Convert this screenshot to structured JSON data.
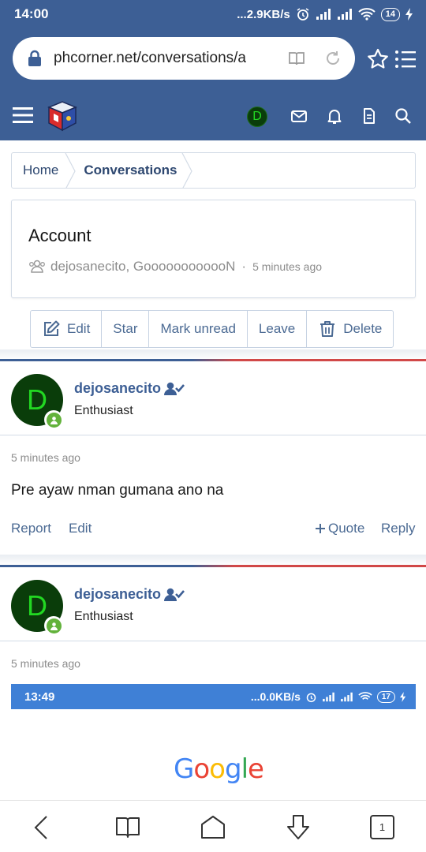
{
  "status_bar": {
    "time": "14:00",
    "network_speed": "...2.9KB/s",
    "battery": "14",
    "icons": [
      "alarm-icon",
      "signal-icon",
      "signal-icon",
      "wifi-icon",
      "battery-icon",
      "charging-icon"
    ]
  },
  "browser": {
    "url": "phcorner.net/conversations/a",
    "icons": [
      "lock-icon",
      "reader-mode-icon",
      "reload-icon",
      "bookmark-star-icon",
      "menu-icon"
    ]
  },
  "site_header": {
    "avatar_letter": "D",
    "icons": [
      "hamburger-icon",
      "logo",
      "mail-icon",
      "bell-icon",
      "document-icon",
      "search-icon"
    ]
  },
  "breadcrumb": {
    "home": "Home",
    "current": "Conversations"
  },
  "conversation": {
    "title": "Account",
    "participants": "dejosanecito, GoooooooooooN",
    "separator": "·",
    "time": "5 minutes ago"
  },
  "actions": {
    "edit": "Edit",
    "star": "Star",
    "mark_unread": "Mark unread",
    "leave": "Leave",
    "delete": "Delete"
  },
  "messages": [
    {
      "avatar_letter": "D",
      "username": "dejosanecito",
      "user_title": "Enthusiast",
      "time": "5 minutes ago",
      "body": "Pre ayaw nman gumana ano na",
      "report": "Report",
      "edit": "Edit",
      "quote": "Quote",
      "reply": "Reply"
    },
    {
      "avatar_letter": "D",
      "username": "dejosanecito",
      "user_title": "Enthusiast",
      "time": "5 minutes ago"
    }
  ],
  "embedded_screenshot": {
    "time": "13:49",
    "network_speed": "...0.0KB/s",
    "battery": "17",
    "logo_text": [
      "G",
      "o",
      "o",
      "g",
      "l",
      "e"
    ],
    "logo_colors": [
      "#4285F4",
      "#EA4335",
      "#FBBC05",
      "#4285F4",
      "#34A853",
      "#EA4335"
    ]
  },
  "bottom_nav": {
    "tab_count": "1",
    "icons": [
      "back-icon",
      "bookmarks-icon",
      "home-icon",
      "download-icon",
      "tabs-icon"
    ]
  },
  "colors": {
    "brand_blue": "#3d5f95",
    "link_blue": "#4b6a93",
    "online_green": "#62b23b",
    "accent_red": "#d14848"
  }
}
